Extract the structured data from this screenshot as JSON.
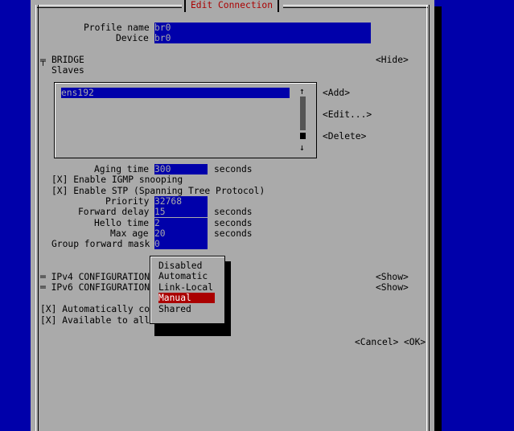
{
  "window": {
    "title": "Edit Connection"
  },
  "profile": {
    "name_label": "Profile name",
    "name_value": "br0",
    "device_label": "Device",
    "device_value": "br0"
  },
  "bridge": {
    "section_marker": "╤",
    "section_label": "BRIDGE",
    "hide_button": "<Hide>",
    "slaves_label": "Slaves",
    "slaves": [
      "ens192"
    ],
    "add_button": "<Add>",
    "edit_button": "<Edit...>",
    "delete_button": "<Delete>",
    "scroll_up": "↑",
    "scroll_down": "↓",
    "aging_time_label": "Aging time",
    "aging_time_value": "300",
    "aging_time_unit": "seconds",
    "igmp_snooping": "[X] Enable IGMP snooping",
    "stp": "[X] Enable STP (Spanning Tree Protocol)",
    "priority_label": "Priority",
    "priority_value": "32768",
    "forward_delay_label": "Forward delay",
    "forward_delay_value": "15",
    "forward_delay_unit": "seconds",
    "hello_time_label": "Hello time",
    "hello_time_value": "2",
    "hello_time_unit": "seconds",
    "max_age_label": "Max age",
    "max_age_value": "20",
    "max_age_unit": "seconds",
    "group_forward_mask_label": "Group forward mask",
    "group_forward_mask_value": "0"
  },
  "ipv4": {
    "label": "═ IPv4 CONFIGURATION",
    "show_button": "<Show>"
  },
  "ipv6": {
    "label": "═ IPv6 CONFIGURATION",
    "show_button": "<Show>"
  },
  "options": {
    "auto_connect": "[X] Automatically co",
    "available_all": "[X] Available to all"
  },
  "footer": {
    "cancel_button": "<Cancel>",
    "ok_button": "<OK>"
  },
  "dropdown": {
    "options": [
      "Disabled",
      "Automatic",
      "Link-Local",
      "Manual",
      "Shared"
    ],
    "selected": "Manual"
  },
  "colors": {
    "background": "#0000aa",
    "dialog": "#aaaaaa",
    "title_text": "#aa0000",
    "selection": "#aa0000",
    "field": "#0000aa"
  }
}
